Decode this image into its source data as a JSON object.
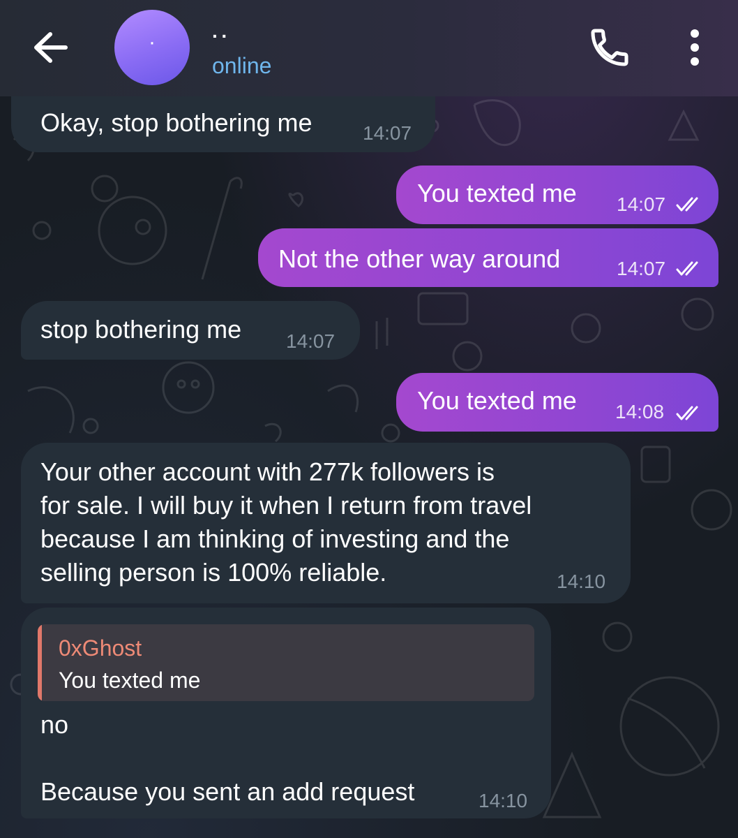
{
  "header": {
    "contact_name": "··",
    "avatar_initial": "·",
    "status": "online"
  },
  "messages": [
    {
      "direction": "incoming",
      "text": "Okay, stop bothering me",
      "time": "14:07"
    },
    {
      "direction": "outgoing",
      "text": "You texted me",
      "time": "14:07",
      "status": "read"
    },
    {
      "direction": "outgoing",
      "text": "Not the other way around",
      "time": "14:07",
      "status": "read"
    },
    {
      "direction": "incoming",
      "text": "stop bothering me",
      "time": "14:07"
    },
    {
      "direction": "outgoing",
      "text": "You texted me",
      "time": "14:08",
      "status": "read"
    },
    {
      "direction": "incoming",
      "text": "Your other account with 277k followers is\nfor sale. I will buy it when I return from travel\nbecause I am thinking of investing and the\nselling person is 100% reliable.",
      "time": "14:10"
    },
    {
      "direction": "incoming",
      "reply_to": {
        "sender": "0xGhost",
        "text": "You texted me"
      },
      "text": "no\n\nBecause you sent an add request",
      "time": "14:10"
    }
  ],
  "colors": {
    "outgoing_bubble": "#9a47d0",
    "incoming_bubble": "#252f39",
    "status_online": "#6fb6ec",
    "reply_accent": "#e0786a"
  },
  "icons": [
    "back-arrow-icon",
    "phone-icon",
    "more-vertical-icon",
    "double-check-icon"
  ]
}
